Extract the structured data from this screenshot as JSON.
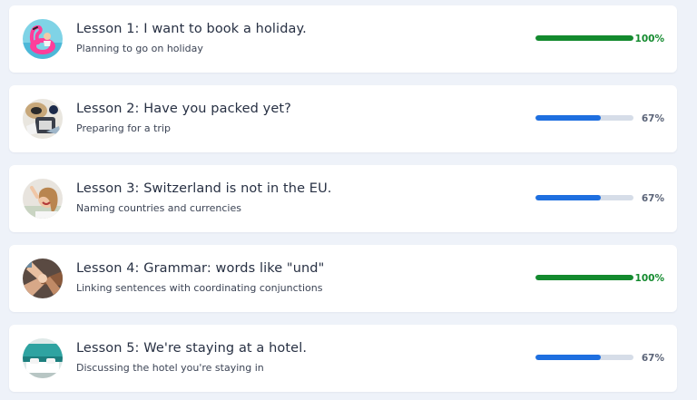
{
  "colors": {
    "complete": "#138a2e",
    "in_progress": "#1e6fe0",
    "track": "#d6dde8",
    "pct_in_progress": "#5b6478"
  },
  "lessons": [
    {
      "title": "Lesson 1: I want to book a holiday.",
      "subtitle": "Planning to go on holiday",
      "progress_label": "100%",
      "progress": 1.0,
      "status": "complete",
      "thumbnail": "flamingo-float-icon"
    },
    {
      "title": "Lesson 2: Have you packed yet?",
      "subtitle": "Preparing for a trip",
      "progress_label": "67%",
      "progress": 0.67,
      "status": "in_progress",
      "thumbnail": "packed-suitcase-icon"
    },
    {
      "title": "Lesson 3: Switzerland is not in the EU.",
      "subtitle": "Naming countries and currencies",
      "progress_label": "67%",
      "progress": 0.67,
      "status": "in_progress",
      "thumbnail": "smiling-woman-icon"
    },
    {
      "title": "Lesson 4: Grammar: words like \"und\"",
      "subtitle": "Linking sentences with coordinating conjunctions",
      "progress_label": "100%",
      "progress": 1.0,
      "status": "complete",
      "thumbnail": "stacked-hands-icon"
    },
    {
      "title": "Lesson 5: We're staying at a hotel.",
      "subtitle": "Discussing the hotel you're staying in",
      "progress_label": "67%",
      "progress": 0.67,
      "status": "in_progress",
      "thumbnail": "hotel-room-icon"
    }
  ]
}
